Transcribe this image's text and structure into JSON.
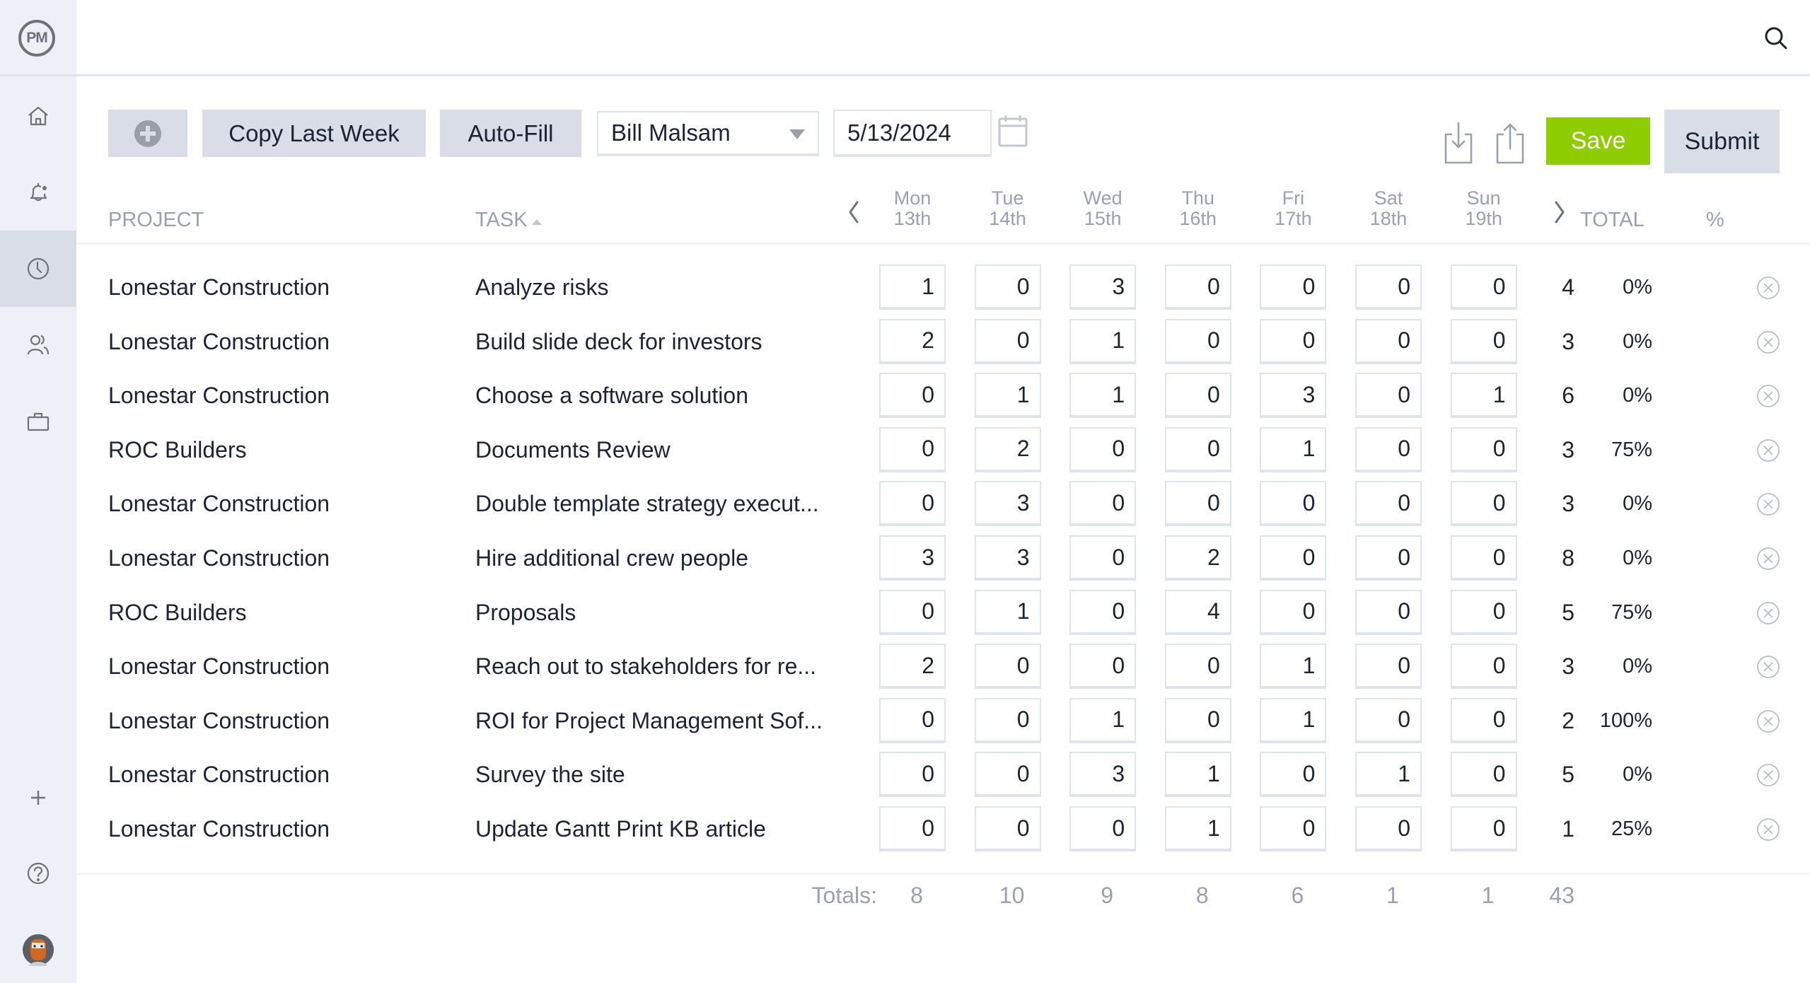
{
  "app": {
    "logo_text": "PM"
  },
  "sidebar": {
    "items": [
      {
        "name": "home",
        "icon": "home-icon",
        "active": false
      },
      {
        "name": "notifications",
        "icon": "bell-icon",
        "active": false
      },
      {
        "name": "timesheets",
        "icon": "clock-icon",
        "active": true
      },
      {
        "name": "team",
        "icon": "users-icon",
        "active": false
      },
      {
        "name": "projects",
        "icon": "briefcase-icon",
        "active": false
      }
    ],
    "bottom": [
      {
        "name": "add",
        "icon": "plus-icon"
      },
      {
        "name": "help",
        "icon": "help-icon"
      },
      {
        "name": "profile",
        "icon": "avatar"
      }
    ]
  },
  "topbar": {
    "search_icon": "search-icon"
  },
  "toolbar": {
    "add_icon": "plus-circle-icon",
    "copy_last_week_label": "Copy Last Week",
    "auto_fill_label": "Auto-Fill",
    "user_select_value": "Bill Malsam",
    "date_value": "5/13/2024",
    "calendar_icon": "calendar-icon",
    "download_icon": "download-icon",
    "upload_icon": "upload-icon",
    "save_label": "Save",
    "submit_label": "Submit",
    "colors": {
      "save": "#8ece00",
      "button_bg": "#d9dde7"
    }
  },
  "table": {
    "headers": {
      "project": "PROJECT",
      "task": "TASK",
      "total": "TOTAL",
      "percent": "%"
    },
    "days": [
      {
        "day": "Mon",
        "date": "13th"
      },
      {
        "day": "Tue",
        "date": "14th"
      },
      {
        "day": "Wed",
        "date": "15th"
      },
      {
        "day": "Thu",
        "date": "16th"
      },
      {
        "day": "Fri",
        "date": "17th"
      },
      {
        "day": "Sat",
        "date": "18th"
      },
      {
        "day": "Sun",
        "date": "19th"
      }
    ],
    "rows": [
      {
        "project": "Lonestar Construction",
        "task": "Analyze risks",
        "hours": [
          "1",
          "0",
          "3",
          "0",
          "0",
          "0",
          "0"
        ],
        "total": "4",
        "percent": "0%"
      },
      {
        "project": "Lonestar Construction",
        "task": "Build slide deck for investors",
        "hours": [
          "2",
          "0",
          "1",
          "0",
          "0",
          "0",
          "0"
        ],
        "total": "3",
        "percent": "0%"
      },
      {
        "project": "Lonestar Construction",
        "task": "Choose a software solution",
        "hours": [
          "0",
          "1",
          "1",
          "0",
          "3",
          "0",
          "1"
        ],
        "total": "6",
        "percent": "0%"
      },
      {
        "project": "ROC Builders",
        "task": "Documents Review",
        "hours": [
          "0",
          "2",
          "0",
          "0",
          "1",
          "0",
          "0"
        ],
        "total": "3",
        "percent": "75%"
      },
      {
        "project": "Lonestar Construction",
        "task": "Double template strategy execut...",
        "hours": [
          "0",
          "3",
          "0",
          "0",
          "0",
          "0",
          "0"
        ],
        "total": "3",
        "percent": "0%"
      },
      {
        "project": "Lonestar Construction",
        "task": "Hire additional crew people",
        "hours": [
          "3",
          "3",
          "0",
          "2",
          "0",
          "0",
          "0"
        ],
        "total": "8",
        "percent": "0%"
      },
      {
        "project": "ROC Builders",
        "task": "Proposals",
        "hours": [
          "0",
          "1",
          "0",
          "4",
          "0",
          "0",
          "0"
        ],
        "total": "5",
        "percent": "75%"
      },
      {
        "project": "Lonestar Construction",
        "task": "Reach out to stakeholders for re...",
        "hours": [
          "2",
          "0",
          "0",
          "0",
          "1",
          "0",
          "0"
        ],
        "total": "3",
        "percent": "0%"
      },
      {
        "project": "Lonestar Construction",
        "task": "ROI for Project Management Sof...",
        "hours": [
          "0",
          "0",
          "1",
          "0",
          "1",
          "0",
          "0"
        ],
        "total": "2",
        "percent": "100%"
      },
      {
        "project": "Lonestar Construction",
        "task": "Survey the site",
        "hours": [
          "0",
          "0",
          "3",
          "1",
          "0",
          "1",
          "0"
        ],
        "total": "5",
        "percent": "0%"
      },
      {
        "project": "Lonestar Construction",
        "task": "Update Gantt Print KB article",
        "hours": [
          "0",
          "0",
          "0",
          "1",
          "0",
          "0",
          "0"
        ],
        "total": "1",
        "percent": "25%"
      }
    ],
    "totals": {
      "label": "Totals:",
      "days": [
        "8",
        "10",
        "9",
        "8",
        "6",
        "1",
        "1"
      ],
      "grand_total": "43"
    }
  }
}
